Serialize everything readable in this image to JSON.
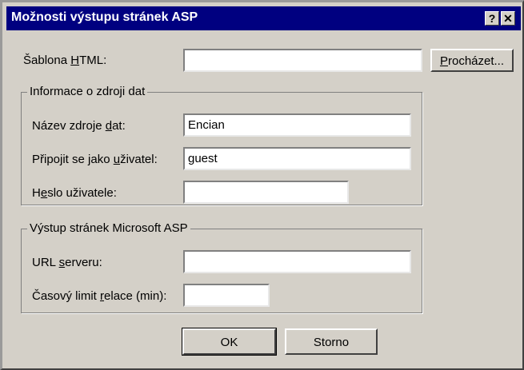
{
  "dialog": {
    "title": "Možnosti výstupu stránek ASP",
    "help_label": "?",
    "close_label": "✕"
  },
  "template": {
    "label_pre": "Šablona ",
    "label_key": "H",
    "label_post": "TML:",
    "value": "",
    "browse_pre": "",
    "browse_key": "P",
    "browse_post": "rocházet..."
  },
  "datasource": {
    "legend": "Informace o zdroji dat",
    "name_pre": "Název zdroje ",
    "name_key": "d",
    "name_post": "at:",
    "name_value": "Encian",
    "user_pre": "Připojit se jako ",
    "user_key": "u",
    "user_post": "živatel:",
    "user_value": "guest",
    "password_pre": "H",
    "password_key": "e",
    "password_post": "slo uživatele:",
    "password_value": ""
  },
  "asp": {
    "legend": "Výstup stránek Microsoft ASP",
    "url_pre": "URL ",
    "url_key": "s",
    "url_post": "erveru:",
    "url_value": "",
    "timeout_pre": "Časový limit ",
    "timeout_key": "r",
    "timeout_post": "elace (min):",
    "timeout_value": ""
  },
  "buttons": {
    "ok": "OK",
    "cancel": "Storno"
  }
}
